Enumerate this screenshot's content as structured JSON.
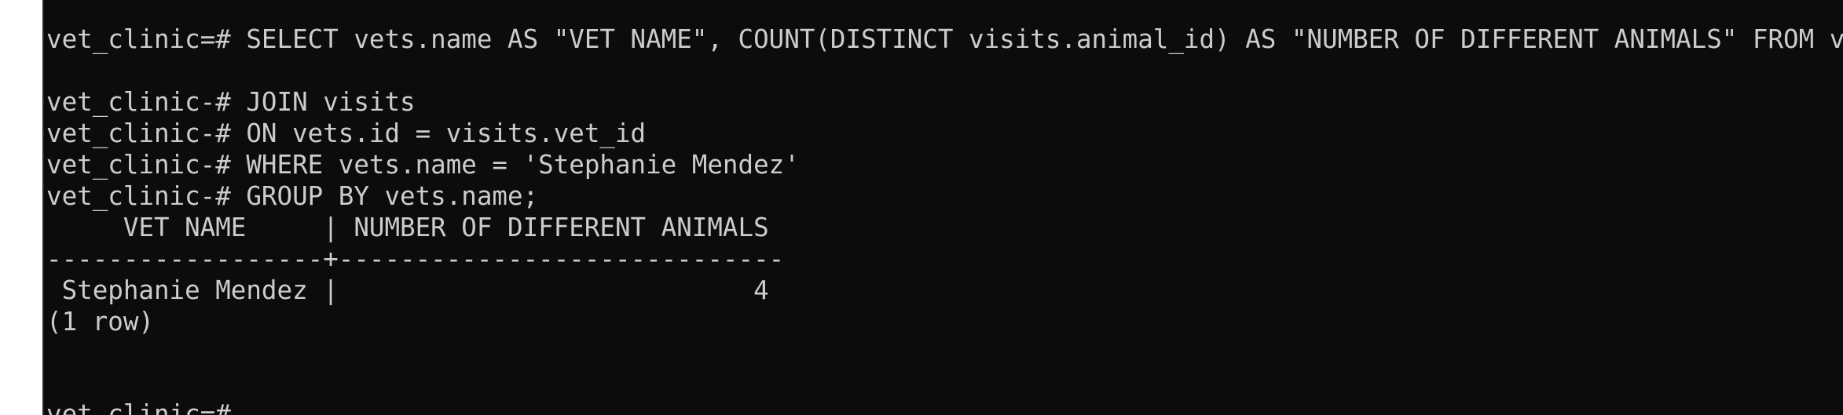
{
  "terminal": {
    "lines": [
      "vet_clinic=# SELECT vets.name AS \"VET NAME\", COUNT(DISTINCT visits.animal_id) AS \"NUMBER OF DIFFERENT ANIMALS\" FROM vets",
      "",
      "vet_clinic-# JOIN visits",
      "vet_clinic-# ON vets.id = visits.vet_id",
      "vet_clinic-# WHERE vets.name = 'Stephanie Mendez'",
      "vet_clinic-# GROUP BY vets.name;",
      "     VET NAME     | NUMBER OF DIFFERENT ANIMALS",
      "------------------+-----------------------------",
      " Stephanie Mendez |                           4",
      "(1 row)",
      "",
      ""
    ],
    "prompt": "vet_clinic=#"
  },
  "colors": {
    "background": "#0c0c0c",
    "foreground": "#cccccc",
    "page_background": "#ffffff"
  }
}
